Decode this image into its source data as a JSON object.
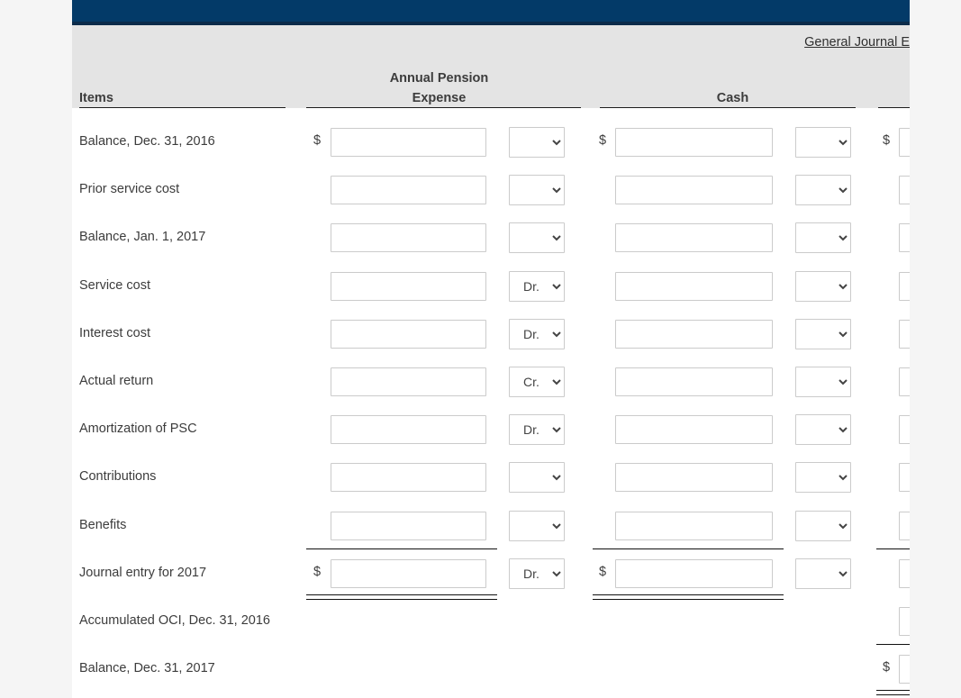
{
  "window": {
    "titlebar_color": "#033a68",
    "header_band_color": "#e4e4e4",
    "page_background": "#f5f5f5"
  },
  "header": {
    "general_journal_link": "General Journal E"
  },
  "columns": [
    {
      "key": "items",
      "label": "Items",
      "align": "left"
    },
    {
      "key": "expense",
      "label": "Annual Pension\nExpense",
      "line1": "Annual Pension",
      "line2": "Expense",
      "align": "center"
    },
    {
      "key": "cash",
      "label": "Cash",
      "align": "center"
    },
    {
      "key": "col4",
      "label": "",
      "align": "center"
    }
  ],
  "dropdown_options": [
    "",
    "Dr.",
    "Cr."
  ],
  "rows": [
    {
      "label": "Balance, Dec. 31, 2016",
      "expense": {
        "dollar": "$",
        "value": "",
        "drcr": ""
      },
      "cash": {
        "dollar": "$",
        "value": "",
        "drcr": ""
      },
      "col4": {
        "dollar": "$",
        "value": ""
      }
    },
    {
      "label": "Prior service cost",
      "expense": {
        "dollar": "",
        "value": "",
        "drcr": ""
      },
      "cash": {
        "dollar": "",
        "value": "",
        "drcr": ""
      },
      "col4": {
        "dollar": "",
        "value": ""
      }
    },
    {
      "label": "Balance, Jan. 1, 2017",
      "expense": {
        "dollar": "",
        "value": "",
        "drcr": ""
      },
      "cash": {
        "dollar": "",
        "value": "",
        "drcr": ""
      },
      "col4": {
        "dollar": "",
        "value": ""
      }
    },
    {
      "label": "Service cost",
      "expense": {
        "dollar": "",
        "value": "",
        "drcr": "Dr."
      },
      "cash": {
        "dollar": "",
        "value": "",
        "drcr": ""
      },
      "col4": {
        "dollar": "",
        "value": ""
      }
    },
    {
      "label": "Interest cost",
      "expense": {
        "dollar": "",
        "value": "",
        "drcr": "Dr."
      },
      "cash": {
        "dollar": "",
        "value": "",
        "drcr": ""
      },
      "col4": {
        "dollar": "",
        "value": ""
      }
    },
    {
      "label": "Actual return",
      "expense": {
        "dollar": "",
        "value": "",
        "drcr": "Cr."
      },
      "cash": {
        "dollar": "",
        "value": "",
        "drcr": ""
      },
      "col4": {
        "dollar": "",
        "value": ""
      }
    },
    {
      "label": "Amortization of PSC",
      "expense": {
        "dollar": "",
        "value": "",
        "drcr": "Dr."
      },
      "cash": {
        "dollar": "",
        "value": "",
        "drcr": ""
      },
      "col4": {
        "dollar": "",
        "value": ""
      }
    },
    {
      "label": "Contributions",
      "expense": {
        "dollar": "",
        "value": "",
        "drcr": ""
      },
      "cash": {
        "dollar": "",
        "value": "",
        "drcr": ""
      },
      "col4": {
        "dollar": "",
        "value": ""
      }
    },
    {
      "label": "Benefits",
      "expense": {
        "dollar": "",
        "value": "",
        "drcr": ""
      },
      "cash": {
        "dollar": "",
        "value": "",
        "drcr": ""
      },
      "col4": {
        "dollar": "",
        "value": ""
      }
    },
    {
      "label": "Journal entry for 2017",
      "expense": {
        "dollar": "$",
        "value": "",
        "drcr": "Dr."
      },
      "cash": {
        "dollar": "$",
        "value": "",
        "drcr": ""
      },
      "col4": {
        "dollar": "",
        "value": ""
      }
    },
    {
      "label": "Accumulated OCI, Dec. 31, 2016",
      "expense": null,
      "cash": null,
      "col4": {
        "dollar": "",
        "value": ""
      }
    },
    {
      "label": "Balance, Dec. 31, 2017",
      "expense": null,
      "cash": null,
      "col4": {
        "dollar": "$",
        "value": ""
      }
    }
  ]
}
